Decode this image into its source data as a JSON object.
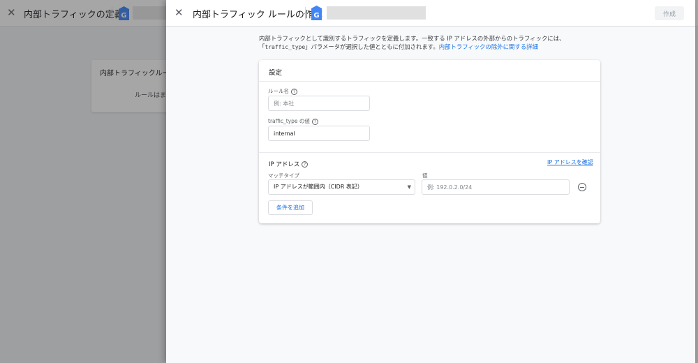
{
  "background_panel": {
    "title": "内部トラフィックの定義",
    "card_title": "内部トラフィックルール",
    "card_text": "ルールはまだ"
  },
  "drawer": {
    "title": "内部トラフィック ルールの作成",
    "create_label": "作成",
    "description": {
      "part1": "内部トラフィックとして識別するトラフィックを定義します。一致する IP アドレスの外部からのトラフィックには、「",
      "code": "traffic_type",
      "part2": "」パラメータが選択した値とともに付加されます。",
      "link": "内部トラフィックの除外に関する詳細"
    },
    "settings": {
      "title": "設定",
      "rule_name_label": "ルール名",
      "rule_name_placeholder": "例: 本社",
      "traffic_type_label": "traffic_type の値",
      "traffic_type_value": "internal",
      "ip_section_title": "IP アドレス",
      "ip_check_link": "IP アドレスを確認",
      "match_type_label": "マッチタイプ",
      "match_type_value": "IP アドレスが範囲内（CIDR 表記）",
      "value_label": "値",
      "value_placeholder": "例: 192.0.2.0/24",
      "add_condition_label": "条件を追加"
    }
  },
  "icons": {
    "close": "close-icon",
    "analytics": "google-analytics-tag-icon",
    "help": "help-icon",
    "dropdown": "dropdown-arrow-icon",
    "remove": "remove-circle-icon"
  },
  "colors": {
    "accent": "#1a73e8",
    "tag_blue": "#4285f4",
    "scrim": "rgba(32,33,36,0.40)"
  }
}
